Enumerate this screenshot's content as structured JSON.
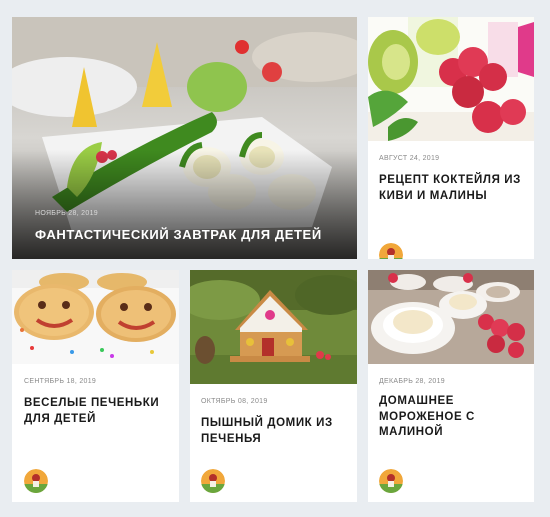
{
  "posts": [
    {
      "date": "Ноябрь 28, 2019",
      "title": "Фантастический завтрак для детей",
      "image": "kids-breakfast-photo"
    },
    {
      "date": "Август 24, 2019",
      "title": "Рецепт коктейля из киви и малины",
      "image": "kiwi-raspberry-popsicle-photo"
    },
    {
      "date": "Сентябрь 18, 2019",
      "title": "Веселые печеньки для детей",
      "image": "smiley-cookies-photo"
    },
    {
      "date": "Октябрь 08, 2019",
      "title": "Пышный домик из печенья",
      "image": "gingerbread-house-photo"
    },
    {
      "date": "Декабрь 28, 2019",
      "title": "Домашнее мороженое с малиной",
      "image": "ice-cream-raspberry-photo"
    }
  ],
  "colors": {
    "background": "#e9edf1",
    "card": "#ffffff",
    "title": "#1a1a1a",
    "date": "#8a8a8a"
  }
}
